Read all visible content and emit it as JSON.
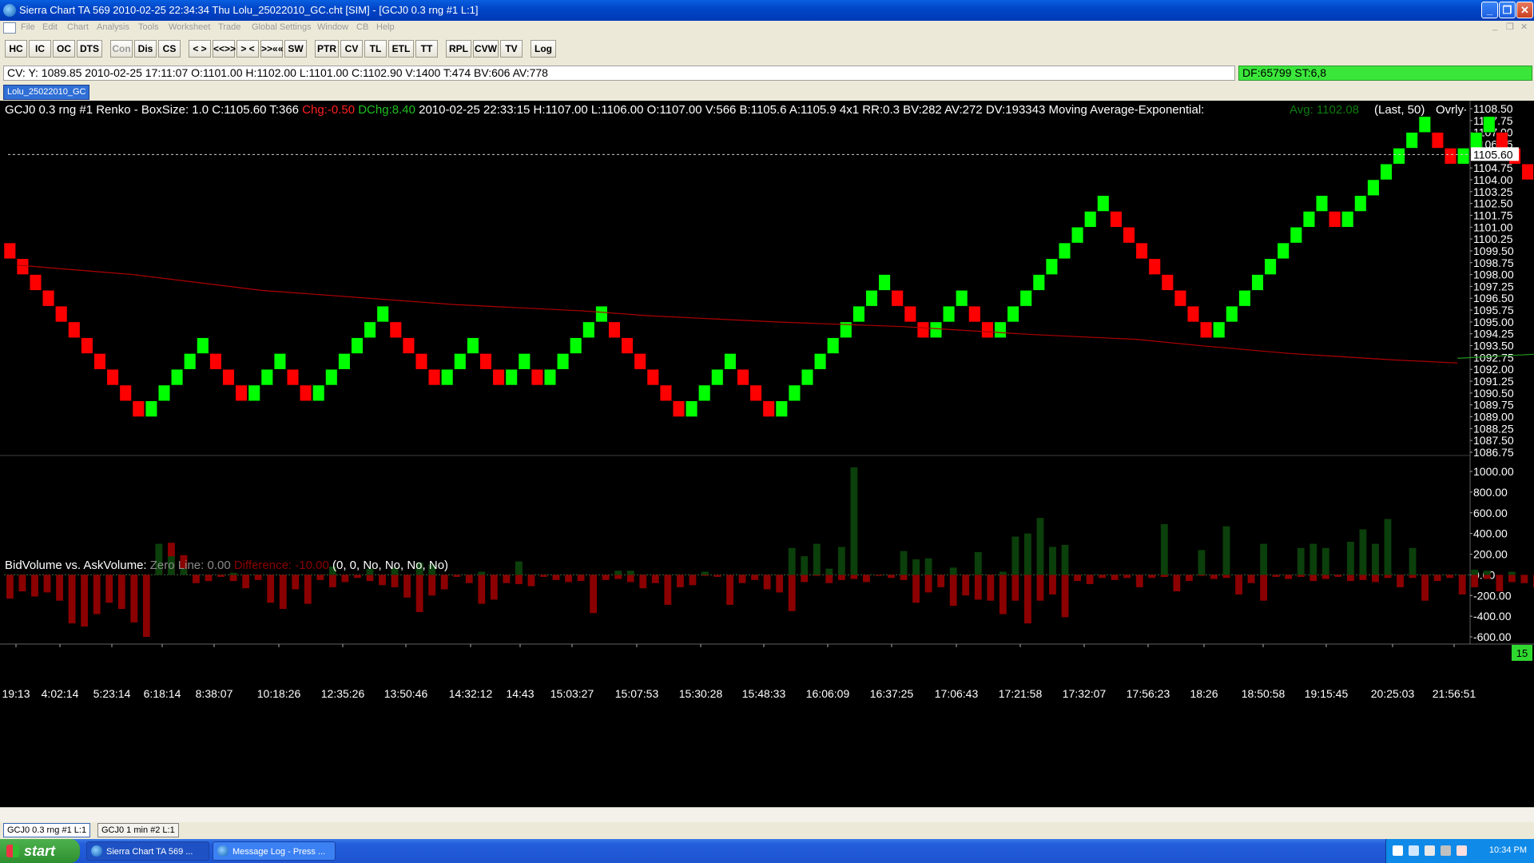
{
  "window": {
    "title": "Sierra Chart TA 569  2010-02-25  22:34:34  Thu   Lolu_25022010_GC.cht [SIM] - [GCJ0  0.3 rng  #1  L:1]",
    "controls": {
      "minimize": "_",
      "restore": "❐",
      "close": "✕"
    }
  },
  "menu": [
    "File",
    "Edit",
    "Chart",
    "Analysis",
    "Tools",
    "Worksheet",
    "Trade",
    "Global Settings",
    "Window",
    "CB",
    "Help"
  ],
  "menu_right": [
    "_",
    "❐",
    "✕"
  ],
  "toolbar": [
    {
      "label": "HC",
      "enabled": true
    },
    {
      "label": "IC",
      "enabled": true
    },
    {
      "label": "OC",
      "enabled": true
    },
    {
      "label": "DTS",
      "enabled": true
    },
    {
      "label": "Con",
      "enabled": false
    },
    {
      "label": "Dis",
      "enabled": true
    },
    {
      "label": "CS",
      "enabled": true
    },
    {
      "label": "< >",
      "enabled": true
    },
    {
      "label": "<<>>",
      "enabled": true
    },
    {
      "label": "> <",
      "enabled": true
    },
    {
      "label": ">>««",
      "enabled": true
    },
    {
      "label": "SW",
      "enabled": true
    },
    {
      "label": "PTR",
      "enabled": true
    },
    {
      "label": "CV",
      "enabled": true
    },
    {
      "label": "TL",
      "enabled": true
    },
    {
      "label": "ETL",
      "enabled": true
    },
    {
      "label": "TT",
      "enabled": true
    },
    {
      "label": "RPL",
      "enabled": true
    },
    {
      "label": "CVW",
      "enabled": true
    },
    {
      "label": "TV",
      "enabled": true
    },
    {
      "label": "Log",
      "enabled": true
    }
  ],
  "cursor_values": "CV: Y: 1089.85  2010-02-25  17:11:07  O:1101.00  H:1102.00  L:1101.00  C:1102.90  V:1400  T:474  BV:606  AV:778",
  "df_status": "DF:65799  ST:6,8",
  "chart_tab": "Lolu_25022010_GC",
  "bottom_tabs": [
    "GCJ0  0.3 rng  #1  L:1",
    "GCJ0  1 min  #2  L:1"
  ],
  "bottom_right_badge": "15",
  "taskbar": {
    "start": "start",
    "tasks": [
      "Sierra Chart TA 569 ...",
      "Message Log - Press ..."
    ],
    "clock": "10:34 PM"
  },
  "colors": {
    "up": "#00ff00",
    "down": "#ff0000",
    "ma_green": "#1f9a1f",
    "ma_red": "#b00000",
    "pos_vol": "#0b3f0b",
    "neg_vol": "#8b0000"
  },
  "chart_data": [
    {
      "type": "renko",
      "header": {
        "main": "GCJ0  0.3 rng  #1 Renko - BoxSize: 1.0 C:1105.60 T:366",
        "chg": "Chg:-0.50",
        "dchg": "DChg:8.40",
        "rest": "2010-02-25 22:33:15 H:1107.00 L:1106.00 O:1107.00 V:566 B:1105.6 A:1105.9 4x1 RR:0.3 BV:282 AV:272 DV:193343 Moving Average-Exponential:",
        "avg": "Avg: 1102.08",
        "last": "(Last, 50)",
        "overlay": "Ovrly-"
      },
      "ylim": [
        1086.75,
        1108.5
      ],
      "y_ticks": [
        "1108.50",
        "1107.75",
        "1107.00",
        "1106.25",
        "1105.60",
        "1104.75",
        "1104.00",
        "1103.25",
        "1102.50",
        "1101.75",
        "1101.00",
        "1100.25",
        "1099.50",
        "1098.75",
        "1098.00",
        "1097.25",
        "1096.50",
        "1095.75",
        "1095.00",
        "1094.25",
        "1093.50",
        "1092.75",
        "1092.00",
        "1091.25",
        "1090.50",
        "1089.75",
        "1089.00",
        "1088.25",
        "1087.50",
        "1086.75"
      ],
      "last_price": 1105.6,
      "ma_label": "Avg",
      "bricks": [
        [
          1100.0,
          1099.0
        ],
        [
          1099.0,
          1098.0
        ],
        [
          1098.0,
          1097.0
        ],
        [
          1097.0,
          1096.0
        ],
        [
          1096.0,
          1095.0
        ],
        [
          1095.0,
          1094.0
        ],
        [
          1094.0,
          1093.0
        ],
        [
          1093.0,
          1092.0
        ],
        [
          1092.0,
          1091.0
        ],
        [
          1091.0,
          1090.0
        ],
        [
          1090.0,
          1089.0
        ],
        [
          1089.0,
          1090.0
        ],
        [
          1090.0,
          1091.0
        ],
        [
          1091.0,
          1092.0
        ],
        [
          1092.0,
          1093.0
        ],
        [
          1093.0,
          1094.0
        ],
        [
          1093.0,
          1092.0
        ],
        [
          1092.0,
          1091.0
        ],
        [
          1091.0,
          1090.0
        ],
        [
          1090.0,
          1091.0
        ],
        [
          1091.0,
          1092.0
        ],
        [
          1092.0,
          1093.0
        ],
        [
          1092.0,
          1091.0
        ],
        [
          1091.0,
          1090.0
        ],
        [
          1090.0,
          1091.0
        ],
        [
          1091.0,
          1092.0
        ],
        [
          1092.0,
          1093.0
        ],
        [
          1093.0,
          1094.0
        ],
        [
          1094.0,
          1095.0
        ],
        [
          1095.0,
          1096.0
        ],
        [
          1095.0,
          1094.0
        ],
        [
          1094.0,
          1093.0
        ],
        [
          1093.0,
          1092.0
        ],
        [
          1092.0,
          1091.0
        ],
        [
          1091.0,
          1092.0
        ],
        [
          1092.0,
          1093.0
        ],
        [
          1093.0,
          1094.0
        ],
        [
          1093.0,
          1092.0
        ],
        [
          1092.0,
          1091.0
        ],
        [
          1091.0,
          1092.0
        ],
        [
          1092.0,
          1093.0
        ],
        [
          1092.0,
          1091.0
        ],
        [
          1091.0,
          1092.0
        ],
        [
          1092.0,
          1093.0
        ],
        [
          1093.0,
          1094.0
        ],
        [
          1094.0,
          1095.0
        ],
        [
          1095.0,
          1096.0
        ],
        [
          1095.0,
          1094.0
        ],
        [
          1094.0,
          1093.0
        ],
        [
          1093.0,
          1092.0
        ],
        [
          1092.0,
          1091.0
        ],
        [
          1091.0,
          1090.0
        ],
        [
          1090.0,
          1089.0
        ],
        [
          1089.0,
          1090.0
        ],
        [
          1090.0,
          1091.0
        ],
        [
          1091.0,
          1092.0
        ],
        [
          1092.0,
          1093.0
        ],
        [
          1092.0,
          1091.0
        ],
        [
          1091.0,
          1090.0
        ],
        [
          1090.0,
          1089.0
        ],
        [
          1089.0,
          1090.0
        ],
        [
          1090.0,
          1091.0
        ],
        [
          1091.0,
          1092.0
        ],
        [
          1092.0,
          1093.0
        ],
        [
          1093.0,
          1094.0
        ],
        [
          1094.0,
          1095.0
        ],
        [
          1095.0,
          1096.0
        ],
        [
          1096.0,
          1097.0
        ],
        [
          1097.0,
          1098.0
        ],
        [
          1097.0,
          1096.0
        ],
        [
          1096.0,
          1095.0
        ],
        [
          1095.0,
          1094.0
        ],
        [
          1094.0,
          1095.0
        ],
        [
          1095.0,
          1096.0
        ],
        [
          1096.0,
          1097.0
        ],
        [
          1096.0,
          1095.0
        ],
        [
          1095.0,
          1094.0
        ],
        [
          1094.0,
          1095.0
        ],
        [
          1095.0,
          1096.0
        ],
        [
          1096.0,
          1097.0
        ],
        [
          1097.0,
          1098.0
        ],
        [
          1098.0,
          1099.0
        ],
        [
          1099.0,
          1100.0
        ],
        [
          1100.0,
          1101.0
        ],
        [
          1101.0,
          1102.0
        ],
        [
          1102.0,
          1103.0
        ],
        [
          1102.0,
          1101.0
        ],
        [
          1101.0,
          1100.0
        ],
        [
          1100.0,
          1099.0
        ],
        [
          1099.0,
          1098.0
        ],
        [
          1098.0,
          1097.0
        ],
        [
          1097.0,
          1096.0
        ],
        [
          1096.0,
          1095.0
        ],
        [
          1095.0,
          1094.0
        ],
        [
          1094.0,
          1095.0
        ],
        [
          1095.0,
          1096.0
        ],
        [
          1096.0,
          1097.0
        ],
        [
          1097.0,
          1098.0
        ],
        [
          1098.0,
          1099.0
        ],
        [
          1099.0,
          1100.0
        ],
        [
          1100.0,
          1101.0
        ],
        [
          1101.0,
          1102.0
        ],
        [
          1102.0,
          1103.0
        ],
        [
          1102.0,
          1101.0
        ],
        [
          1101.0,
          1102.0
        ],
        [
          1102.0,
          1103.0
        ],
        [
          1103.0,
          1104.0
        ],
        [
          1104.0,
          1105.0
        ],
        [
          1105.0,
          1106.0
        ],
        [
          1106.0,
          1107.0
        ],
        [
          1107.0,
          1108.0
        ],
        [
          1107.0,
          1106.0
        ],
        [
          1106.0,
          1105.0
        ],
        [
          1105.0,
          1106.0
        ],
        [
          1106.0,
          1107.0
        ],
        [
          1107.0,
          1108.0
        ],
        [
          1107.0,
          1106.0
        ],
        [
          1106.0,
          1105.0
        ],
        [
          1105.0,
          1104.0
        ],
        [
          1104.0,
          1105.0
        ],
        [
          1105.0,
          1106.0
        ],
        [
          1106.0,
          1107.0
        ],
        [
          1107.0,
          1108.0
        ],
        [
          1107.0,
          1106.0
        ]
      ],
      "ema": [
        [
          1,
          1098.6
        ],
        [
          10,
          1098.0
        ],
        [
          20,
          1097.0
        ],
        [
          35,
          1096.1
        ],
        [
          45,
          1095.7
        ],
        [
          50,
          1095.4
        ],
        [
          60,
          1095.0
        ],
        [
          70,
          1094.7
        ],
        [
          80,
          1094.2
        ],
        [
          88,
          1093.9
        ],
        [
          93,
          1093.5
        ],
        [
          100,
          1093.0
        ],
        [
          108,
          1092.6
        ],
        [
          113,
          1092.4
        ]
      ],
      "ema2": [
        [
          113,
          1092.7
        ],
        [
          120,
          1093.0
        ],
        [
          130,
          1093.4
        ],
        [
          140,
          1093.8
        ],
        [
          150,
          1094.4
        ],
        [
          160,
          1095.2
        ],
        [
          170,
          1096.0
        ],
        [
          178,
          1096.2
        ],
        [
          190,
          1096.7
        ],
        [
          200,
          1097.5
        ],
        [
          210,
          1098.6
        ],
        [
          218,
          1099.5
        ],
        [
          230,
          1100.5
        ],
        [
          240,
          1101.3
        ],
        [
          250,
          1101.8
        ],
        [
          262,
          1102.3
        ]
      ]
    },
    {
      "type": "bar",
      "title": "BidVolume vs. AskVolume:",
      "zero_line_label": "Zero Line: 0.00",
      "difference_label": "Difference: -10.00",
      "params": "(0, 0, No, No, No, No)",
      "ylim": [
        -600,
        1000
      ],
      "y_ticks": [
        "1000.00",
        "800.00",
        "600.00",
        "400.00",
        "200.00",
        "0.00",
        "-200.00",
        "-400.00",
        "-600.00"
      ],
      "values": [
        -230,
        -160,
        -210,
        -170,
        -250,
        -470,
        -500,
        -380,
        -270,
        -330,
        -460,
        -600,
        110,
        310,
        190,
        -80,
        -60,
        -20,
        -60,
        -130,
        -50,
        -270,
        -330,
        -140,
        -280,
        -50,
        -120,
        -70,
        -30,
        -60,
        -100,
        -120,
        -220,
        -360,
        -200,
        -140,
        -20,
        -80,
        -280,
        -240,
        -80,
        -90,
        -110,
        -20,
        -50,
        -70,
        -60,
        -370,
        -50,
        -40,
        -70,
        -130,
        -80,
        -290,
        -120,
        -100,
        -10,
        -20,
        -290,
        -80,
        -50,
        -140,
        -170,
        -350,
        -70,
        -10,
        -80,
        -50,
        -40,
        -70,
        -10,
        -30,
        -50,
        -270,
        -170,
        -120,
        -300,
        -200,
        -240,
        -250,
        -380,
        -250,
        -470,
        -250,
        -190,
        -410,
        -60,
        -90,
        -30,
        -50,
        -30,
        -120,
        -30,
        -20,
        -160,
        -60,
        -10,
        -40,
        -30,
        -190,
        -80,
        -250,
        -20,
        -40,
        -20,
        -60,
        -40,
        -20,
        -60,
        -50,
        -70,
        -30,
        -120,
        -30,
        -250,
        -60,
        -30,
        -190,
        -120,
        -40,
        -160,
        -70,
        -80,
        -120,
        -30,
        -20,
        -70,
        -40,
        -30,
        -140,
        -70,
        -20,
        -100,
        -20
      ],
      "positive_values": [
        [
          5,
          0
        ],
        [
          12,
          300
        ],
        [
          13,
          180
        ],
        [
          14,
          60
        ],
        [
          18,
          20
        ],
        [
          26,
          80
        ],
        [
          29,
          60
        ],
        [
          31,
          70
        ],
        [
          33,
          120
        ],
        [
          34,
          100
        ],
        [
          38,
          30
        ],
        [
          41,
          130
        ],
        [
          49,
          40
        ],
        [
          50,
          40
        ],
        [
          56,
          30
        ],
        [
          63,
          260
        ],
        [
          64,
          180
        ],
        [
          65,
          300
        ],
        [
          66,
          60
        ],
        [
          67,
          270
        ],
        [
          68,
          1040
        ],
        [
          72,
          230
        ],
        [
          73,
          150
        ],
        [
          74,
          160
        ],
        [
          76,
          70
        ],
        [
          78,
          220
        ],
        [
          80,
          30
        ],
        [
          81,
          370
        ],
        [
          82,
          400
        ],
        [
          83,
          550
        ],
        [
          84,
          270
        ],
        [
          85,
          290
        ],
        [
          93,
          490
        ],
        [
          96,
          240
        ],
        [
          98,
          470
        ],
        [
          101,
          300
        ],
        [
          104,
          260
        ],
        [
          105,
          300
        ],
        [
          106,
          260
        ],
        [
          108,
          320
        ],
        [
          109,
          440
        ],
        [
          110,
          300
        ],
        [
          111,
          540
        ],
        [
          113,
          260
        ],
        [
          118,
          50
        ],
        [
          119,
          40
        ],
        [
          121,
          30
        ]
      ]
    }
  ],
  "x_ticks": [
    "19:13",
    "4:02:14",
    "5:23:14",
    "6:18:14",
    "8:38:07",
    "10:18:26",
    "12:35:26",
    "13:50:46",
    "14:32:12",
    "14:43",
    "15:03:27",
    "15:07:53",
    "15:30:28",
    "15:48:33",
    "16:06:09",
    "16:37:25",
    "17:06:43",
    "17:21:58",
    "17:32:07",
    "17:56:23",
    "18:26",
    "18:50:58",
    "19:15:45",
    "20:25:03",
    "21:56:51"
  ]
}
